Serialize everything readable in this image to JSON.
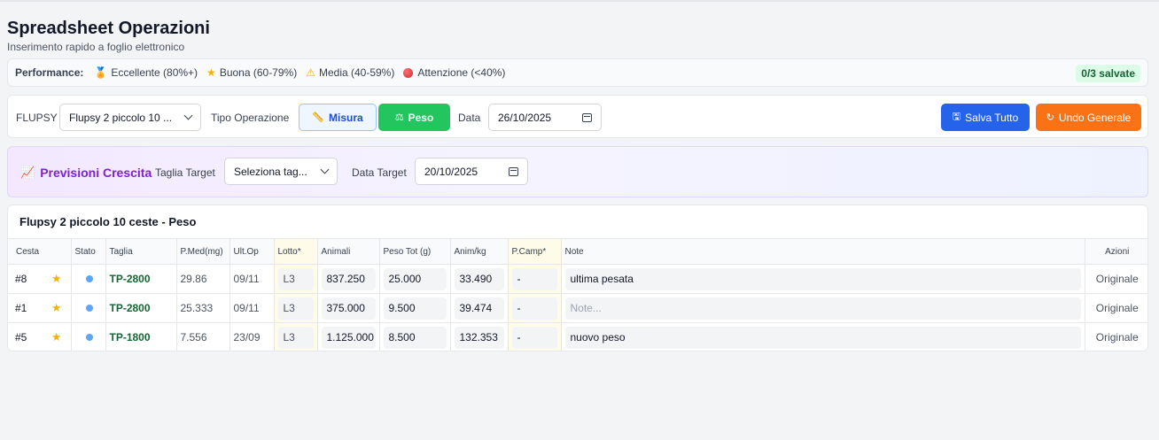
{
  "header": {
    "title": "Spreadsheet Operazioni",
    "subtitle": "Inserimento rapido a foglio elettronico"
  },
  "performance": {
    "label": "Performance:",
    "items": [
      {
        "icon": "trophy-icon",
        "label": "Eccellente (80%+)"
      },
      {
        "icon": "star-icon",
        "label": "Buona (60-79%)"
      },
      {
        "icon": "warning-icon",
        "label": "Media (40-59%)"
      },
      {
        "icon": "red-circle-icon",
        "label": "Attenzione (<40%)"
      }
    ],
    "saved_badge": "0/3 salvate"
  },
  "toolbar": {
    "flupsy_label": "FLUPSY",
    "flupsy_value": "Flupsy 2 piccolo 10 ...",
    "tipo_label": "Tipo Operazione",
    "misura_label": "Misura",
    "peso_label": "Peso",
    "data_label": "Data",
    "data_value": "26/10/2025",
    "salva_label": "Salva Tutto",
    "undo_label": "Undo Generale"
  },
  "growth": {
    "title": "Previsioni Crescita",
    "taglia_label": "Taglia Target",
    "taglia_value": "Seleziona tag...",
    "data_label": "Data Target",
    "data_value": "20/10/2025"
  },
  "table": {
    "title": "Flupsy 2 piccolo 10 ceste - Peso",
    "columns": [
      "Cesta",
      "Stato",
      "Taglia",
      "P.Med(mg)",
      "Ult.Op",
      "Lotto*",
      "Animali",
      "Peso Tot (g)",
      "Anim/kg",
      "P.Camp*",
      "Note",
      "Azioni"
    ],
    "rows": [
      {
        "cesta": "#8",
        "taglia": "TP-2800",
        "pmed": "29.86",
        "ultop": "09/11",
        "lotto": "L3",
        "animali": "837.250",
        "peso": "25.000",
        "animkg": "33.490",
        "pcamp": "-",
        "note": "ultima pesata",
        "note_placeholder": "",
        "azioni": "Originale"
      },
      {
        "cesta": "#1",
        "taglia": "TP-2800",
        "pmed": "25.333",
        "ultop": "09/11",
        "lotto": "L3",
        "animali": "375.000",
        "peso": "9.500",
        "animkg": "39.474",
        "pcamp": "-",
        "note": "",
        "note_placeholder": "Note...",
        "azioni": "Originale"
      },
      {
        "cesta": "#5",
        "taglia": "TP-1800",
        "pmed": "7.556",
        "ultop": "23/09",
        "lotto": "L3",
        "animali": "1.125.000",
        "peso": "8.500",
        "animkg": "132.353",
        "pcamp": "-",
        "note": "nuovo peso",
        "note_placeholder": "",
        "azioni": "Originale"
      }
    ]
  },
  "colors": {
    "accent_blue": "#2563eb",
    "success_green": "#22c55e",
    "warning_orange": "#f97316",
    "purple": "#7e22ce"
  }
}
